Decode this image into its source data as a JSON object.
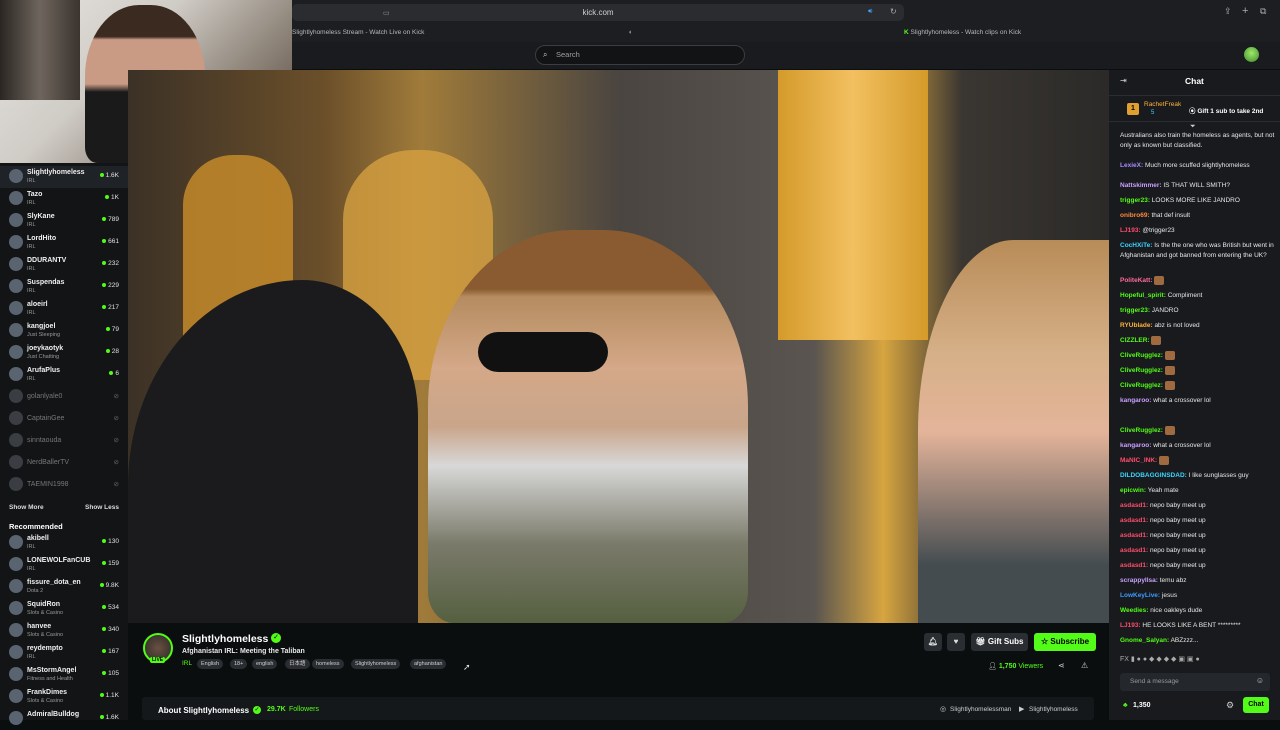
{
  "browser": {
    "url": "kick.com",
    "tab_stream": "Slightlyhomeless Stream - Watch Live on Kick",
    "tab_clips": "Slightlyhomeless - Watch clips on Kick"
  },
  "search": {
    "placeholder": "Search"
  },
  "sidebar": {
    "following": [
      {
        "name": "Slightlyhomeless",
        "category": "IRL",
        "viewers": "1.6K",
        "live": true
      },
      {
        "name": "Tazo",
        "category": "IRL",
        "viewers": "1K",
        "live": true
      },
      {
        "name": "SlyKane",
        "category": "IRL",
        "viewers": "789",
        "live": true
      },
      {
        "name": "LordHito",
        "category": "IRL",
        "viewers": "661",
        "live": true
      },
      {
        "name": "DDURANTV",
        "category": "IRL",
        "viewers": "232",
        "live": true
      },
      {
        "name": "Suspendas",
        "category": "IRL",
        "viewers": "229",
        "live": true
      },
      {
        "name": "aloeirl",
        "category": "IRL",
        "viewers": "217",
        "live": true
      },
      {
        "name": "kangjoel",
        "category": "Just Sleeping",
        "viewers": "79",
        "live": true
      },
      {
        "name": "joeykaotyk",
        "category": "Just Chatting",
        "viewers": "28",
        "live": true
      },
      {
        "name": "ArufaPlus",
        "category": "IRL",
        "viewers": "6",
        "live": true
      },
      {
        "name": "golanlyale0",
        "category": "",
        "viewers": "",
        "live": false
      },
      {
        "name": "CaptainGee",
        "category": "",
        "viewers": "",
        "live": false
      },
      {
        "name": "sinntaouda",
        "category": "",
        "viewers": "",
        "live": false
      },
      {
        "name": "NerdBallerTV",
        "category": "",
        "viewers": "",
        "live": false
      },
      {
        "name": "TAEMIN1998",
        "category": "",
        "viewers": "",
        "live": false
      }
    ],
    "show_more": "Show More",
    "show_less": "Show Less",
    "recommended_title": "Recommended",
    "recommended": [
      {
        "name": "akibell",
        "category": "IRL",
        "viewers": "130"
      },
      {
        "name": "LONEWOLFanCUB",
        "category": "IRL",
        "viewers": "159"
      },
      {
        "name": "fissure_dota_en",
        "category": "Dota 2",
        "viewers": "9.8K"
      },
      {
        "name": "SquidRon",
        "category": "Slots & Casino",
        "viewers": "534"
      },
      {
        "name": "hanvee",
        "category": "Slots & Casino",
        "viewers": "340"
      },
      {
        "name": "reydempto",
        "category": "IRL",
        "viewers": "167"
      },
      {
        "name": "MsStormAngel",
        "category": "Fitness and Health",
        "viewers": "105"
      },
      {
        "name": "FrankDimes",
        "category": "Slots & Casino",
        "viewers": "1.1K"
      },
      {
        "name": "AdmiralBulldog",
        "category": "",
        "viewers": "1.6K"
      }
    ]
  },
  "stream": {
    "channel": "Slightlyhomeless",
    "title": "Afghanistan IRL: Meeting the Taliban",
    "category": "IRL",
    "live_badge": "LIVE",
    "tags": [
      "English",
      "18+",
      "english",
      "日本語",
      "homeless",
      "Slightlyhomeless",
      "afghanistan"
    ],
    "viewers": "1,750",
    "viewers_label": "Viewers",
    "gift_subs": "Gift Subs",
    "subscribe": "Subscribe",
    "about": "About Slightlyhomeless",
    "followers": "29.7K",
    "followers_label": "Followers",
    "social_1": "Slightlyhomelessman",
    "social_2": "Slightlyhomeless"
  },
  "chat": {
    "title": "Chat",
    "pinned_user": "RachetFreak",
    "pinned_count": "5",
    "pinned_text": "Gift 1 sub to take 2nd",
    "messages": [
      {
        "user": "",
        "text": "Australians also train the homeless as agents, but not only as known but classified.",
        "color": "#e8e8e8"
      },
      {
        "user": "LexieX:",
        "text": "Much more scuffed slightlyhomeless",
        "color": "#a88bff"
      },
      {
        "user": "Nattskimmer:",
        "text": "IS THAT WILL SMITH?",
        "color": "#c9a0ff"
      },
      {
        "user": "trigger23:",
        "text": "LOOKS MORE LIKE JANDRO",
        "color": "#53fc18"
      },
      {
        "user": "onibro69:",
        "text": "that def insult",
        "color": "#ff8a3d"
      },
      {
        "user": "LJ193:",
        "text": "@trigger23",
        "color": "#ff4d6d"
      },
      {
        "user": "CocHXiTe:",
        "text": "Is the the one who was British but went in Afghanistan and got banned from entering the UK?",
        "color": "#3dd6ff"
      },
      {
        "user": "PoliteKatt:",
        "text": "",
        "color": "#ff6b9a"
      },
      {
        "user": "Hopeful_spirit:",
        "text": "Compliment",
        "color": "#53fc18"
      },
      {
        "user": "trigger23:",
        "text": "JANDRO",
        "color": "#53fc18"
      },
      {
        "user": "RYUblade:",
        "text": "abz is not loved",
        "color": "#ffb23d"
      },
      {
        "user": "CIZZLER:",
        "text": "",
        "color": "#53fc18"
      },
      {
        "user": "CliveRugglez:",
        "text": "",
        "color": "#53fc18"
      },
      {
        "user": "CliveRugglez:",
        "text": "",
        "color": "#53fc18"
      },
      {
        "user": "CliveRugglez:",
        "text": "",
        "color": "#53fc18"
      },
      {
        "user": "kangaroo:",
        "text": "what a crossover lol",
        "color": "#c9a0ff"
      },
      {
        "user": "CliveRugglez:",
        "text": "",
        "color": "#53fc18"
      },
      {
        "user": "kangaroo:",
        "text": "what a crossover lol",
        "color": "#c9a0ff"
      },
      {
        "user": "MaNIC_INK:",
        "text": "",
        "color": "#ff4d6d"
      },
      {
        "user": "DILDOBAGGINSDAD:",
        "text": "I like sunglasses guy",
        "color": "#3dd6ff"
      },
      {
        "user": "epicwin:",
        "text": "Yeah mate",
        "color": "#53fc18"
      },
      {
        "user": "asdasd1:",
        "text": "nepo baby meet up",
        "color": "#ff4d6d"
      },
      {
        "user": "asdasd1:",
        "text": "nepo baby meet up",
        "color": "#ff4d6d"
      },
      {
        "user": "asdasd1:",
        "text": "nepo baby meet up",
        "color": "#ff4d6d"
      },
      {
        "user": "asdasd1:",
        "text": "nepo baby meet up",
        "color": "#ff4d6d"
      },
      {
        "user": "asdasd1:",
        "text": "nepo baby meet up",
        "color": "#ff4d6d"
      },
      {
        "user": "scrappyllsa:",
        "text": "temu abz",
        "color": "#c9a0ff"
      },
      {
        "user": "LowKeyLive:",
        "text": "jesus",
        "color": "#3d9bff"
      },
      {
        "user": "Weedies:",
        "text": "nice oakleys dude",
        "color": "#53fc18"
      },
      {
        "user": "LJ193:",
        "text": "HE LOOKS LIKE A BENT *********",
        "color": "#ff4d6d"
      },
      {
        "user": "Gnome_Salyan:",
        "text": "ABZzzz...",
        "color": "#53fc18"
      }
    ],
    "input_placeholder": "Send a message",
    "points": "1,350",
    "chat_button": "Chat"
  }
}
